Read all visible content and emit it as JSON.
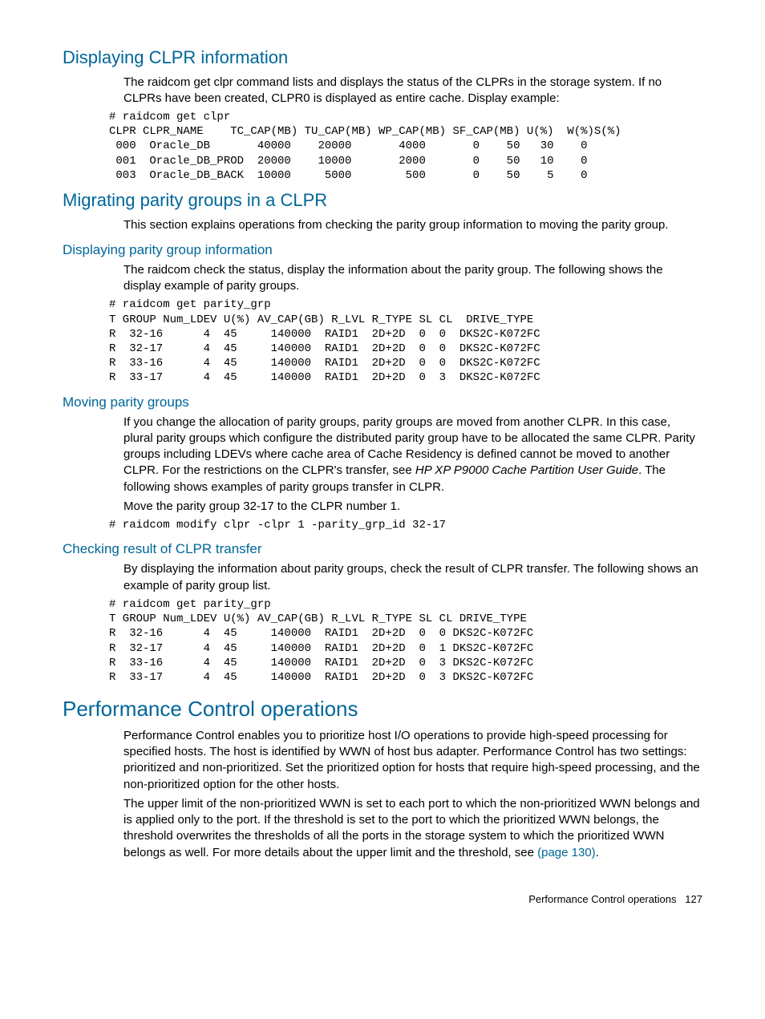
{
  "s1": {
    "heading": "Displaying CLPR information",
    "p1": "The raidcom get clpr command lists and displays the status of the CLPRs in the storage system. If no CLPRs have been created, CLPR0 is displayed as entire cache. Display example:",
    "code": "# raidcom get clpr\nCLPR CLPR_NAME    TC_CAP(MB) TU_CAP(MB) WP_CAP(MB) SF_CAP(MB) U(%)  W(%)S(%)\n 000  Oracle_DB       40000    20000       4000       0    50   30    0\n 001  Oracle_DB_PROD  20000    10000       2000       0    50   10    0\n 003  Oracle_DB_BACK  10000     5000        500       0    50    5    0"
  },
  "s2": {
    "heading": "Migrating parity groups in a CLPR",
    "p1": "This section explains operations from checking the parity group information to moving the parity group."
  },
  "s3": {
    "heading": "Displaying parity group information",
    "p1": "The raidcom check the status, display the information about the parity group. The following shows the display example of parity groups.",
    "code": "# raidcom get parity_grp\nT GROUP Num_LDEV U(%) AV_CAP(GB) R_LVL R_TYPE SL CL  DRIVE_TYPE\nR  32-16      4  45     140000  RAID1  2D+2D  0  0  DKS2C-K072FC\nR  32-17      4  45     140000  RAID1  2D+2D  0  0  DKS2C-K072FC\nR  33-16      4  45     140000  RAID1  2D+2D  0  0  DKS2C-K072FC\nR  33-17      4  45     140000  RAID1  2D+2D  0  3  DKS2C-K072FC"
  },
  "s4": {
    "heading": "Moving parity groups",
    "p1a": "If you change the allocation of parity groups, parity groups are moved from another CLPR. In this case, plural parity groups which configure the distributed parity group have to be allocated the same CLPR. Parity groups including LDEVs where cache area of Cache Residency is defined cannot be moved to another CLPR. For the restrictions on the CLPR's transfer, see ",
    "p1b_italic": "HP XP P9000 Cache Partition User Guide",
    "p1c": ". The following shows examples of parity groups transfer in CLPR.",
    "p2": "Move the parity group 32-17 to the CLPR number 1.",
    "code": "# raidcom modify clpr -clpr 1 -parity_grp_id 32-17"
  },
  "s5": {
    "heading": "Checking result of CLPR transfer",
    "p1": "By displaying the information about parity groups, check the result of CLPR transfer. The following shows an example of parity group list.",
    "code": "# raidcom get parity_grp\nT GROUP Num_LDEV U(%) AV_CAP(GB) R_LVL R_TYPE SL CL DRIVE_TYPE\nR  32-16      4  45     140000  RAID1  2D+2D  0  0 DKS2C-K072FC\nR  32-17      4  45     140000  RAID1  2D+2D  0  1 DKS2C-K072FC\nR  33-16      4  45     140000  RAID1  2D+2D  0  3 DKS2C-K072FC\nR  33-17      4  45     140000  RAID1  2D+2D  0  3 DKS2C-K072FC"
  },
  "s6": {
    "heading": "Performance Control operations",
    "p1": "Performance Control enables you to prioritize host I/O operations to provide high-speed processing for specified hosts. The host is identified by WWN of host bus adapter. Performance Control has two settings: prioritized and non-prioritized. Set the prioritized option for hosts that require high-speed processing, and the non-prioritized option for the other hosts.",
    "p2a": "The upper limit of the non-prioritized WWN is set to each port to which the non-prioritized WWN belongs and is applied only to the port. If the threshold is set to the port to which the prioritized WWN belongs, the threshold overwrites the thresholds of all the ports in the storage system to which the prioritized WWN belongs as well. For more details about the upper limit and the threshold, see ",
    "p2b_link": "(page 130)",
    "p2c": "."
  },
  "footer": {
    "label": "Performance Control operations",
    "page": "127"
  }
}
